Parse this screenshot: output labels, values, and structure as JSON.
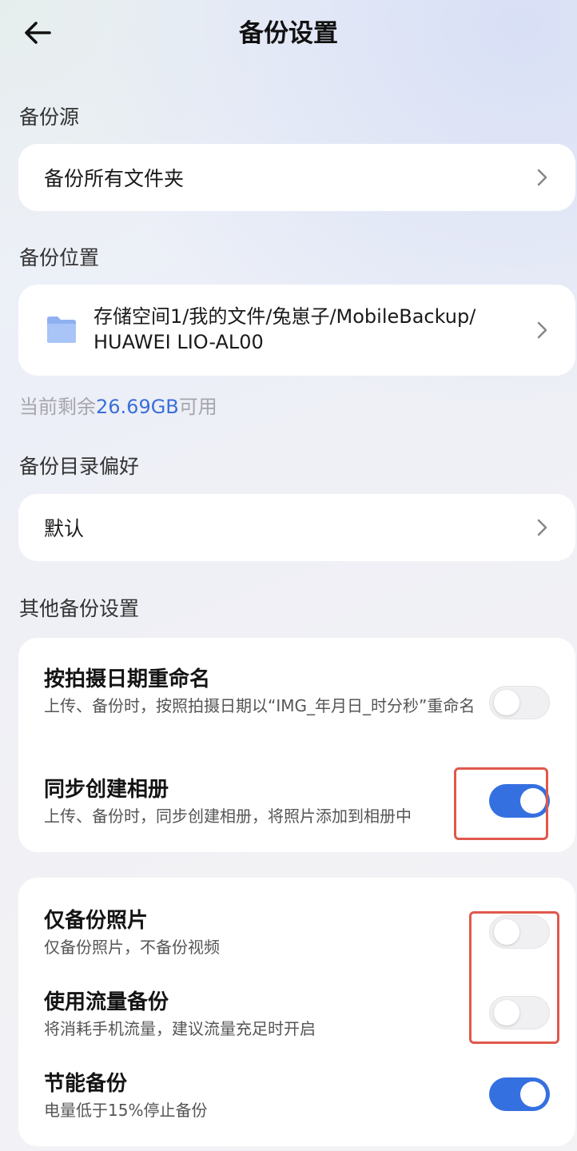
{
  "header": {
    "title": "备份设置",
    "back_icon": "arrow-left-icon"
  },
  "source": {
    "label": "备份源",
    "value": "备份所有文件夹"
  },
  "location": {
    "label": "备份位置",
    "path_line1": "存储空间1/我的文件/兔崽子/MobileBackup/",
    "path_line2": "HUAWEI LIO-AL00",
    "storage_prefix": "当前剩余",
    "storage_value": "26.69GB",
    "storage_suffix": "可用"
  },
  "directory": {
    "label": "备份目录偏好",
    "value": "默认"
  },
  "other": {
    "label": "其他备份设置",
    "items": [
      {
        "title": "按拍摄日期重命名",
        "desc": "上传、备份时，按照拍摄日期以“IMG_年月日_时分秒”重命名",
        "enabled": false
      },
      {
        "title": "同步创建相册",
        "desc": "上传、备份时，同步创建相册，将照片添加到相册中",
        "enabled": true
      }
    ]
  },
  "more": {
    "items": [
      {
        "title": "仅备份照片",
        "desc": "仅备份照片，不备份视频",
        "enabled": false
      },
      {
        "title": "使用流量备份",
        "desc": "将消耗手机流量，建议流量充足时开启",
        "enabled": false
      },
      {
        "title": "节能备份",
        "desc": "电量低于15%停止备份",
        "enabled": true
      }
    ]
  },
  "colors": {
    "accent": "#3570e0",
    "storage_highlight": "#3a6fd8",
    "annotation": "#e0584b"
  }
}
